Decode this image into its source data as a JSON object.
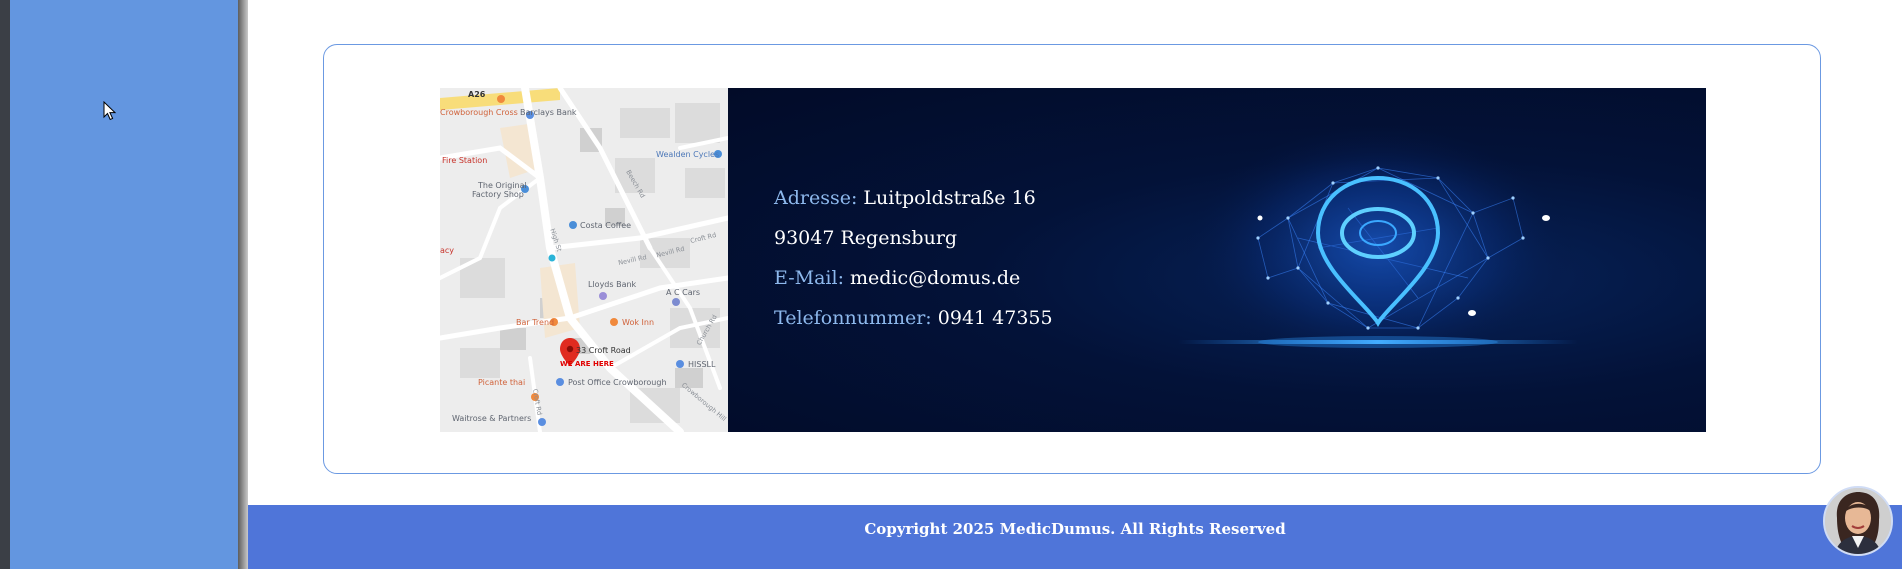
{
  "map": {
    "road_badge": "A26",
    "labels": [
      "Crowborough Cross",
      "Barclays Bank",
      "Wealden Cycles",
      "Fire Station",
      "The Original",
      "Factory Shop",
      "Costa Coffee",
      "Lloyds Bank",
      "A C Cars",
      "Bar Trend",
      "Wok Inn",
      "33 Croft Road",
      "WE ARE HERE",
      "HISSLL",
      "Picante thai",
      "Post Office Crowborough",
      "Waitrose & Partners",
      "acy"
    ],
    "streets": [
      "High St",
      "Beech Rd",
      "Nevill Rd",
      "Nevill Rd",
      "Croft Rd",
      "Crowborough Hill",
      "Church Rd",
      "Croft Rd"
    ]
  },
  "contact": {
    "address_label": "Adresse:",
    "address_value": "Luitpoldstraße 16",
    "city": "93047 Regensburg",
    "email_label": "E-Mail:",
    "email_value": "medic@domus.de",
    "phone_label": "Telefonnummer:",
    "phone_value": "0941 47355"
  },
  "footer": {
    "copyright": "Copyright 2025 MedicDumus. All Rights Reserved"
  },
  "colors": {
    "sidebar": "#6396e0",
    "footer": "#4f75d9",
    "card_border": "#6b99e2",
    "panel_dark": "#020b28",
    "label_blue": "#8db8ec"
  },
  "icons": {
    "cursor": "cursor-icon",
    "map_pin": "location-pin-icon",
    "avatar": "support-agent-avatar"
  }
}
